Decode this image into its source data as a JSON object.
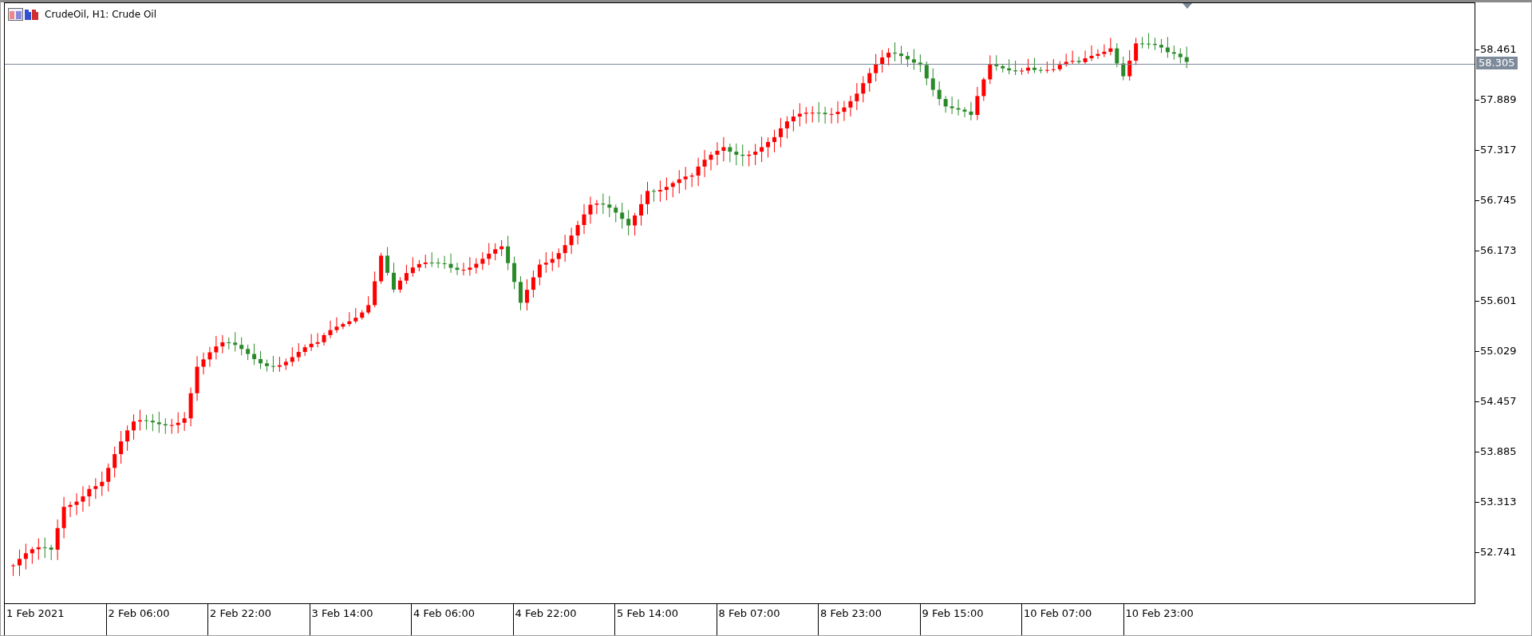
{
  "chart": {
    "title": "CrudeOil, H1:  Crude Oil",
    "price_ticks": [
      "58.461",
      "57.889",
      "57.317",
      "56.745",
      "56.173",
      "55.601",
      "55.029",
      "54.457",
      "53.885",
      "53.313",
      "52.741"
    ],
    "current_price": "58.305",
    "time_labels": [
      "1 Feb 2021",
      "2 Feb 06:00",
      "2 Feb 22:00",
      "3 Feb 14:00",
      "4 Feb 06:00",
      "4 Feb 22:00",
      "5 Feb 14:00",
      "8 Feb 07:00",
      "8 Feb 23:00",
      "9 Feb 15:00",
      "10 Feb 07:00",
      "10 Feb 23:00"
    ]
  }
}
